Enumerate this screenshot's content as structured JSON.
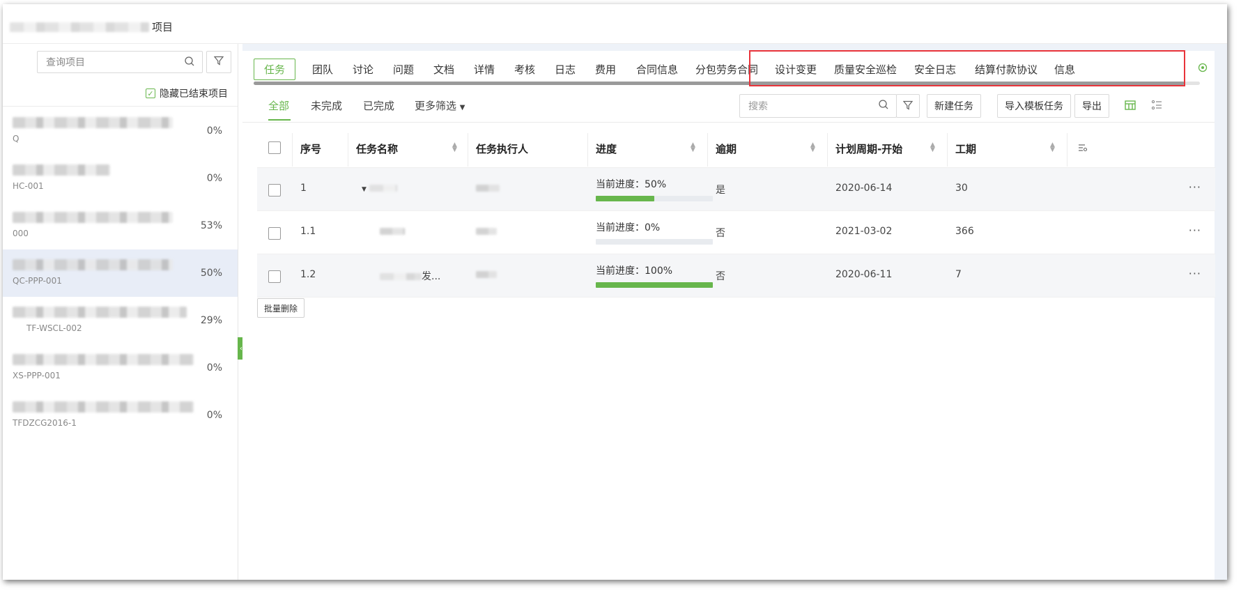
{
  "header": {
    "title_suffix": "项目"
  },
  "sidebar": {
    "search_placeholder": "查询项目",
    "hide_ended_label": "隐藏已结束项目",
    "projects": [
      {
        "code": "Q",
        "percent": "0%"
      },
      {
        "code": "HC-001",
        "percent": "0%"
      },
      {
        "code": "000",
        "percent": "53%"
      },
      {
        "code": "QC-PPP-001",
        "percent": "50%"
      },
      {
        "code": "TF-WSCL-002",
        "percent": "29%"
      },
      {
        "code": "XS-PPP-001",
        "percent": "0%"
      },
      {
        "code": "TFDZCG2016-1",
        "percent": "0%"
      }
    ]
  },
  "tabs": [
    "任务",
    "团队",
    "讨论",
    "问题",
    "文档",
    "详情",
    "考核",
    "日志",
    "费用",
    "合同信息",
    "分包劳务合同",
    "设计变更",
    "质量安全巡检",
    "安全日志",
    "结算付款协议",
    "信息"
  ],
  "subtabs": {
    "all": "全部",
    "incomplete": "未完成",
    "completed": "已完成",
    "more_filter": "更多筛选"
  },
  "toolbar": {
    "search_placeholder": "搜索",
    "new_task": "新建任务",
    "import_template": "导入模板任务",
    "export": "导出"
  },
  "table": {
    "headers": {
      "seq": "序号",
      "name": "任务名称",
      "executor": "任务执行人",
      "progress": "进度",
      "overdue": "逾期",
      "plan_start": "计划周期-开始",
      "duration": "工期"
    },
    "rows": [
      {
        "seq": "1",
        "progress_label": "当前进度：50%",
        "progress": 0.5,
        "overdue": "是",
        "plan_start": "2020-06-14",
        "duration": "30",
        "name_tail": ""
      },
      {
        "seq": "1.1",
        "progress_label": "当前进度：0%",
        "progress": 0,
        "overdue": "否",
        "plan_start": "2021-03-02",
        "duration": "366",
        "name_tail": ""
      },
      {
        "seq": "1.2",
        "progress_label": "当前进度：100%",
        "progress": 1,
        "overdue": "否",
        "plan_start": "2020-06-11",
        "duration": "7",
        "name_tail": "发..."
      }
    ]
  },
  "batch_delete": "批量删除",
  "colors": {
    "accent": "#67b64c",
    "highlight": "#e8333a"
  }
}
